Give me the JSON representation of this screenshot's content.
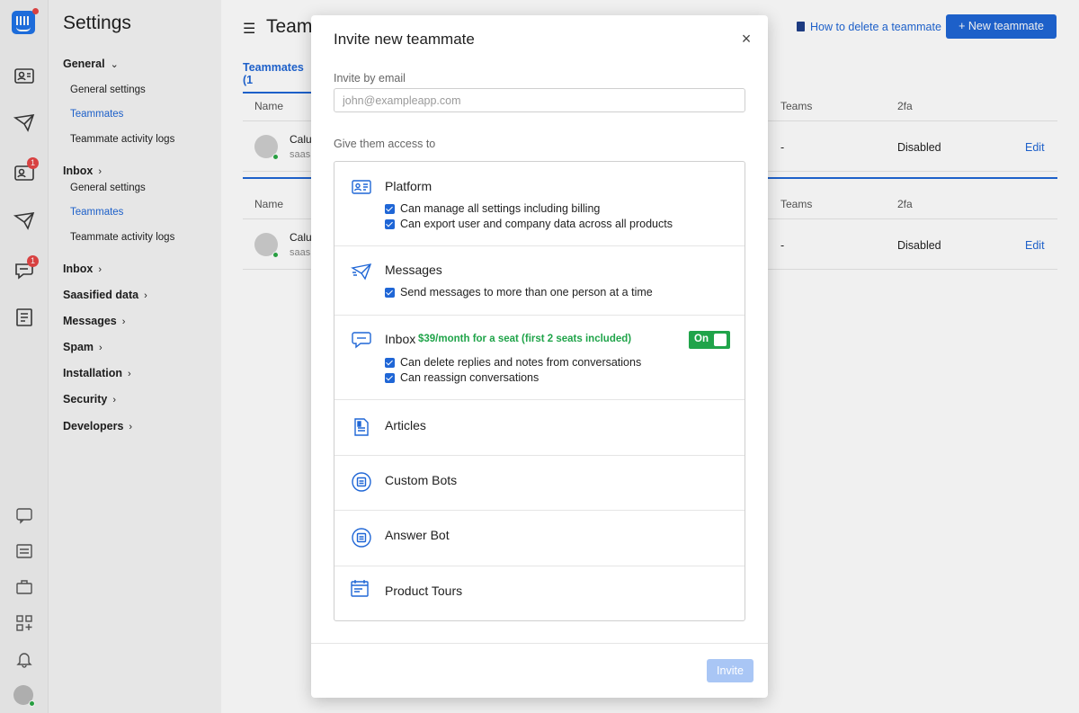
{
  "rail": {
    "badges": {
      "inbox": "1",
      "messages": "1"
    }
  },
  "settings": {
    "title": "Settings",
    "general_head": "General",
    "general_items": [
      "General settings",
      "Teammates",
      "Teammate activity logs"
    ],
    "inbox_head": "Inbox",
    "inbox_items": [
      "General settings",
      "Teammates",
      "Teammate activity logs"
    ],
    "nav": [
      "Inbox",
      "Saasified data",
      "Messages",
      "Spam",
      "Installation",
      "Security",
      "Developers"
    ]
  },
  "main": {
    "page_title": "Teammates",
    "help_link": "How to delete a teammate",
    "new_button": "New teammate",
    "tab": "Teammates (1",
    "columns": {
      "name": "Name",
      "teams": "Teams",
      "twofa": "2fa"
    },
    "rows": [
      {
        "name": "Calu",
        "sub": "saas",
        "teams": "-",
        "twofa": "Disabled",
        "edit": "Edit"
      },
      {
        "name": "Calu",
        "sub": "saas",
        "teams": "-",
        "twofa": "Disabled",
        "edit": "Edit"
      }
    ]
  },
  "modal": {
    "title": "Invite new teammate",
    "close": "×",
    "email_label": "Invite by email",
    "email_placeholder": "john@exampleapp.com",
    "email_value": "",
    "access_label": "Give them access to",
    "sections": [
      {
        "title": "Platform",
        "icon": "platform-icon",
        "perms": [
          "Can manage all settings including billing",
          "Can export user and company data across all products"
        ]
      },
      {
        "title": "Messages",
        "icon": "paper-plane-icon",
        "perms": [
          "Send messages to more than one person at a time"
        ]
      },
      {
        "title": "Inbox",
        "icon": "chat-bubble-icon",
        "price": "$39/month for a seat (first 2 seats included)",
        "toggle": "On",
        "perms": [
          "Can delete replies and notes from conversations",
          "Can reassign conversations"
        ]
      },
      {
        "title": "Articles",
        "icon": "article-icon"
      },
      {
        "title": "Custom Bots",
        "icon": "bot-icon"
      },
      {
        "title": "Answer Bot",
        "icon": "bot-icon"
      },
      {
        "title": "Product Tours",
        "icon": "tour-icon"
      }
    ],
    "invite_button": "Invite"
  },
  "colors": {
    "accent": "#1f66d6",
    "success": "#20a44a",
    "badge": "#e64646",
    "disabled_button": "#a9c6f5"
  }
}
